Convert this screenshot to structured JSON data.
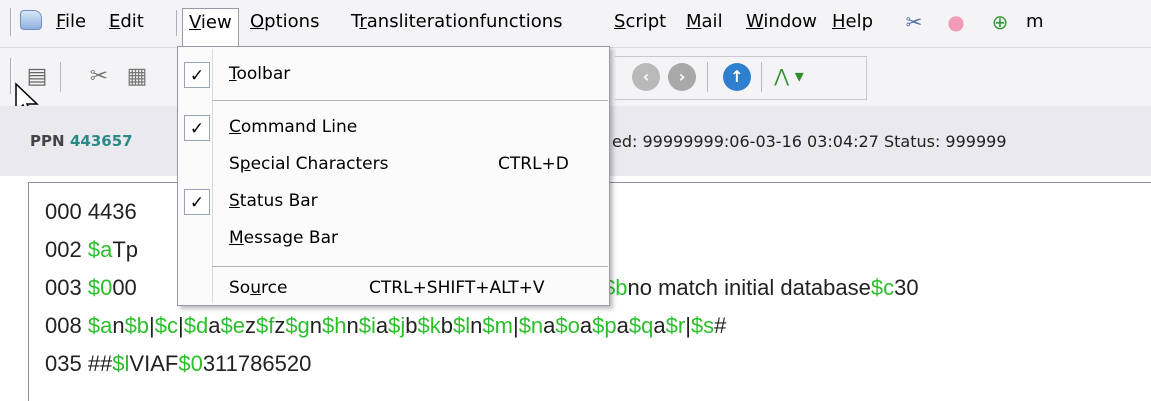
{
  "menubar": {
    "items": [
      {
        "label": "File",
        "u": "F",
        "rest": "ile"
      },
      {
        "label": "Edit",
        "u": "E",
        "rest": "dit"
      },
      {
        "label": "View",
        "u": "V",
        "rest": "iew"
      },
      {
        "label": "Options",
        "u": "O",
        "rest": "ptions"
      },
      {
        "label": "Transliterationfunctions",
        "pre": "T",
        "u": "r",
        "rest": "ansliterationfunctions"
      },
      {
        "label": "Script",
        "u": "S",
        "rest": "cript"
      },
      {
        "label": "Mail",
        "u": "M",
        "rest": "ail"
      },
      {
        "label": "Window",
        "u": "W",
        "rest": "indow"
      },
      {
        "label": "Help",
        "u": "H",
        "rest": "elp"
      },
      {
        "label": "m"
      }
    ],
    "icons": [
      "app-icon",
      "scissors-icon",
      "piggy-bank-icon",
      "globe-icon"
    ]
  },
  "view_menu": {
    "items": [
      {
        "label": "Toolbar",
        "u": "T",
        "rest": "oolbar",
        "checked": true,
        "shortcut": ""
      },
      {
        "label": "Command Line",
        "u": "C",
        "rest": "ommand Line",
        "checked": true,
        "shortcut": ""
      },
      {
        "label": "Special Characters",
        "pre": "S",
        "u": "p",
        "rest": "ecial Characters",
        "checked": false,
        "shortcut": "CTRL+D"
      },
      {
        "label": "Status Bar",
        "u": "S",
        "rest": "tatus Bar",
        "checked": true,
        "shortcut": ""
      },
      {
        "label": "Message Bar",
        "u": "M",
        "rest": "essage Bar",
        "checked": false,
        "shortcut": ""
      },
      {
        "label": "Source",
        "pre": "So",
        "u": "u",
        "rest": "rce",
        "checked": false,
        "shortcut": "CTRL+SHIFT+ALT+V"
      }
    ],
    "check_mark": "✓"
  },
  "toolbar": {
    "icons": [
      "print-icon",
      "cut-icon",
      "paste-icon",
      "back-icon",
      "forward-icon",
      "up-icon",
      "tree-dropdown-icon"
    ]
  },
  "record": {
    "ppn_label": "PPN",
    "ppn_value": "443657",
    "info": "ed: 99999999:06-03-16 03:04:27 Status: 999999"
  },
  "editor": {
    "lines": [
      [
        {
          "t": "000 4436"
        }
      ],
      [
        {
          "t": "002 "
        },
        {
          "t": "$a",
          "g": true
        },
        {
          "t": "Tp"
        }
      ],
      [
        {
          "t": "003 "
        },
        {
          "t": "$0",
          "g": true
        },
        {
          "t": "00"
        }
      ],
      [
        {
          "t": "008 "
        },
        {
          "t": "$a",
          "g": true
        },
        {
          "t": "n"
        },
        {
          "t": "$b",
          "g": true
        },
        {
          "t": "|"
        },
        {
          "t": "$c",
          "g": true
        },
        {
          "t": "|"
        },
        {
          "t": "$d",
          "g": true
        },
        {
          "t": "a"
        },
        {
          "t": "$e",
          "g": true
        },
        {
          "t": "z"
        },
        {
          "t": "$f",
          "g": true
        },
        {
          "t": "z"
        },
        {
          "t": "$g",
          "g": true
        },
        {
          "t": "n"
        },
        {
          "t": "$h",
          "g": true
        },
        {
          "t": "n"
        },
        {
          "t": "$i",
          "g": true
        },
        {
          "t": "a"
        },
        {
          "t": "$j",
          "g": true
        },
        {
          "t": "b"
        },
        {
          "t": "$k",
          "g": true
        },
        {
          "t": "b"
        },
        {
          "t": "$l",
          "g": true
        },
        {
          "t": "n"
        },
        {
          "t": "$m",
          "g": true
        },
        {
          "t": "|"
        },
        {
          "t": "$n",
          "g": true
        },
        {
          "t": "a"
        },
        {
          "t": "$o",
          "g": true
        },
        {
          "t": "a"
        },
        {
          "t": "$p",
          "g": true
        },
        {
          "t": "a"
        },
        {
          "t": "$q",
          "g": true
        },
        {
          "t": "a"
        },
        {
          "t": "$r",
          "g": true
        },
        {
          "t": "|"
        },
        {
          "t": "$s",
          "g": true
        },
        {
          "t": "#"
        }
      ],
      [
        {
          "t": "035 ##"
        },
        {
          "t": "$l",
          "g": true
        },
        {
          "t": "VIAF"
        },
        {
          "t": "$0",
          "g": true
        },
        {
          "t": "311786520"
        }
      ]
    ],
    "line3_tail": [
      {
        "t": "$b",
        "g": true
      },
      {
        "t": "no match initial database"
      },
      {
        "t": "$c",
        "g": true
      },
      {
        "t": "30"
      }
    ]
  },
  "colors": {
    "subfield": "#2bbf2b",
    "ppn": "#2a8a88"
  }
}
